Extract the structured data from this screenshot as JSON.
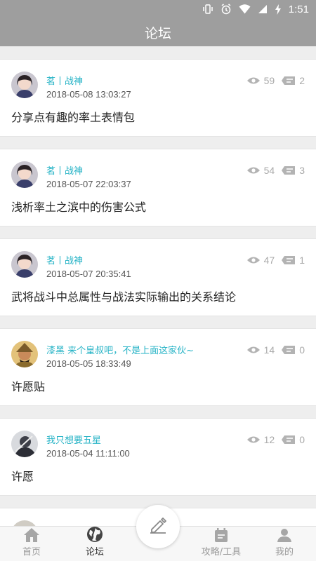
{
  "status_bar": {
    "time": "1:51",
    "icons": [
      "vibrate-icon",
      "alarm-icon",
      "wifi-icon",
      "signal-icon",
      "battery-charging-icon"
    ]
  },
  "header": {
    "title": "论坛"
  },
  "posts": [
    {
      "author": "茗丨战神",
      "time": "2018-05-08 13:03:27",
      "title": "分享点有趣的率土表情包",
      "views": "59",
      "comments": "2",
      "avatar": "avatar-girl"
    },
    {
      "author": "茗丨战神",
      "time": "2018-05-07 22:03:37",
      "title": "浅析率土之滨中的伤害公式",
      "views": "54",
      "comments": "3",
      "avatar": "avatar-girl"
    },
    {
      "author": "茗丨战神",
      "time": "2018-05-07 20:35:41",
      "title": "武将战斗中总属性与战法实际输出的关系结论",
      "views": "47",
      "comments": "1",
      "avatar": "avatar-girl"
    },
    {
      "author": "漆黑 来个皇叔吧，不是上面这家伙~",
      "time": "2018-05-05 18:33:49",
      "title": "许愿贴",
      "views": "14",
      "comments": "0",
      "avatar": "avatar-general"
    },
    {
      "author": "我只想要五星",
      "time": "2018-05-04 11:11:00",
      "title": "许愿",
      "views": "12",
      "comments": "0",
      "avatar": "avatar-dark"
    }
  ],
  "tabbar": {
    "items": [
      {
        "label": "首页",
        "icon": "home-icon",
        "active": false
      },
      {
        "label": "论坛",
        "icon": "globe-icon",
        "active": true
      },
      {
        "label": "",
        "icon": "edit-icon",
        "active": false
      },
      {
        "label": "攻略/工具",
        "icon": "calendar-icon",
        "active": false
      },
      {
        "label": "我的",
        "icon": "person-icon",
        "active": false
      }
    ]
  },
  "colors": {
    "header_bg": "#9e9e9e",
    "author": "#26b3c6",
    "page_bg": "#eeeeee"
  }
}
